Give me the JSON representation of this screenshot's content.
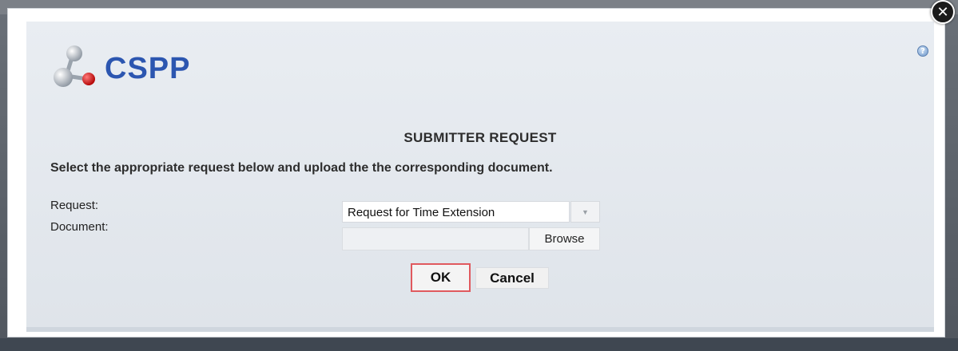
{
  "dialog": {
    "close_symbol": "✕",
    "help_symbol": "?",
    "logo_text": "CSPP",
    "title": "SUBMITTER REQUEST",
    "instructions": "Select the appropriate request below and upload the the corresponding document."
  },
  "form": {
    "request_label": "Request:",
    "request_value": "Request for Time Extension",
    "document_label": "Document:",
    "document_value": "",
    "browse_label": "Browse"
  },
  "actions": {
    "ok_label": "OK",
    "cancel_label": "Cancel"
  },
  "colors": {
    "brand_blue": "#2c56b0",
    "ok_focus_border": "#e0595e",
    "panel_bg": "#e4e8ee"
  },
  "icons": {
    "logo": "molecule-logo-icon",
    "help": "help-icon",
    "close": "close-icon",
    "dropdown": "chevron-down-icon"
  }
}
